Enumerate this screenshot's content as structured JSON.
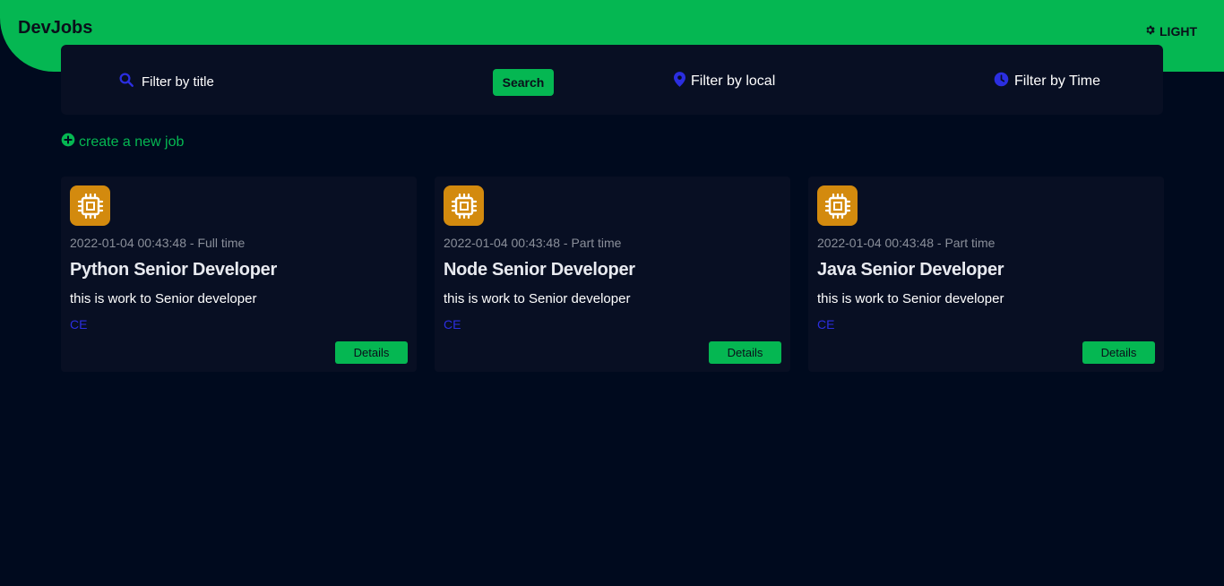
{
  "header": {
    "logo": "DevJobs",
    "theme_label": "LIGHT",
    "theme_icon": "gear-icon",
    "background": "#05b752"
  },
  "filters": {
    "title_placeholder": "Filter by title",
    "search_label": "Search",
    "local_label": "Filter by local",
    "time_label": "Filter by Time",
    "icon_color": "#2b2ee0"
  },
  "create_link": {
    "label": "create a new job",
    "icon": "plus-circle-icon"
  },
  "jobs": [
    {
      "meta": "2022-01-04 00:43:48 - Full time",
      "title": "Python Senior Developer",
      "description": "this is work to Senior developer",
      "location": "CE",
      "details_label": "Details",
      "icon": "cpu-chip-icon"
    },
    {
      "meta": "2022-01-04 00:43:48 - Part time",
      "title": "Node Senior Developer",
      "description": "this is work to Senior developer",
      "location": "CE",
      "details_label": "Details",
      "icon": "cpu-chip-icon"
    },
    {
      "meta": "2022-01-04 00:43:48 - Part time",
      "title": "Java Senior Developer",
      "description": "this is work to Senior developer",
      "location": "CE",
      "details_label": "Details",
      "icon": "cpu-chip-icon"
    }
  ],
  "colors": {
    "page_bg": "#000a1e",
    "card_bg": "#080f23",
    "accent_green": "#05b752",
    "icon_orange": "#d38a0e",
    "link_blue": "#2b2ee0"
  }
}
